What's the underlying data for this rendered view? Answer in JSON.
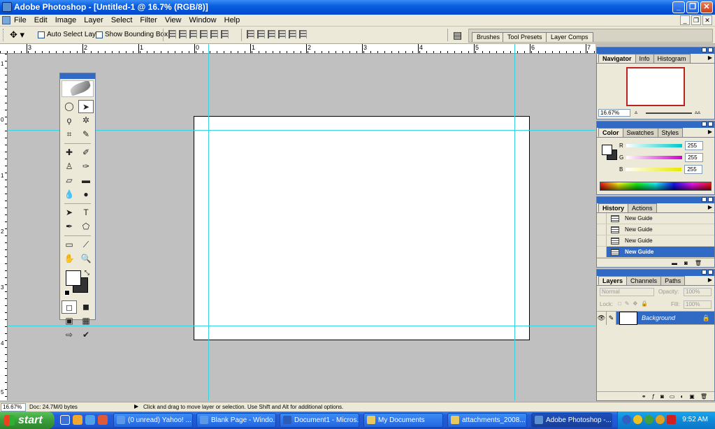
{
  "window": {
    "title": "Adobe Photoshop - [Untitled-1 @ 16.7% (RGB/8)]"
  },
  "menu": [
    "File",
    "Edit",
    "Image",
    "Layer",
    "Select",
    "Filter",
    "View",
    "Window",
    "Help"
  ],
  "options": {
    "auto_select": "Auto Select Layer",
    "bounding_box": "Show Bounding Box"
  },
  "palette_well": [
    "Brushes",
    "Tool Presets",
    "Layer Comps"
  ],
  "rulers": {
    "top": [
      "3",
      "2",
      "1",
      "0",
      "1",
      "2",
      "3",
      "4",
      "5",
      "6",
      "7"
    ],
    "left": [
      "1",
      "0",
      "1",
      "2",
      "3",
      "4",
      "5"
    ]
  },
  "navigator": {
    "tabs": [
      "Navigator",
      "Info",
      "Histogram"
    ],
    "zoom": "16.67%"
  },
  "color_panel": {
    "tabs": [
      "Color",
      "Swatches",
      "Styles"
    ],
    "channels": [
      {
        "label": "R",
        "value": "255",
        "color": "#00c8c8"
      },
      {
        "label": "G",
        "value": "255",
        "color": "#d000d0"
      },
      {
        "label": "B",
        "value": "255",
        "color": "#e8e800"
      }
    ]
  },
  "history": {
    "tabs": [
      "History",
      "Actions"
    ],
    "items": [
      "New Guide",
      "New Guide",
      "New Guide",
      "New Guide"
    ]
  },
  "layers": {
    "tabs": [
      "Layers",
      "Channels",
      "Paths"
    ],
    "blend": "Normal",
    "opacity_label": "Opacity:",
    "opacity": "100%",
    "lock_label": "Lock:",
    "fill_label": "Fill:",
    "fill": "100%",
    "layer_name": "Background"
  },
  "status": {
    "zoom": "16.67%",
    "doc": "Doc: 24.7M/0 bytes",
    "hint": "Click and drag to move layer or selection.  Use Shift and Alt for additional options."
  },
  "taskbar": {
    "start": "start",
    "tasks": [
      "(0 unread) Yahoo! ...",
      "Blank Page - Windo...",
      "Document1 - Micros...",
      "My Documents",
      "attachments_2008...",
      "Adobe Photoshop -..."
    ],
    "clock": "9:52 AM"
  }
}
